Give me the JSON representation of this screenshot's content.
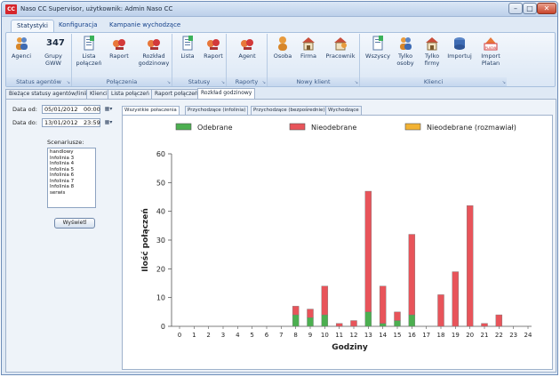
{
  "window": {
    "app_icon": "CC",
    "title": "Naso CC Supervisor, użytkownik: Admin Naso CC",
    "buttons": {
      "minimize": "–",
      "maximize": "□",
      "close": "✕"
    }
  },
  "ribbon_tabs": [
    "Statystyki",
    "Konfiguracja",
    "Kampanie wychodzące"
  ],
  "ribbon_groups": [
    {
      "name": "Status agentów",
      "buttons": [
        {
          "label": "Agenci",
          "icon": "agents-icon"
        },
        {
          "label": "Grupy GWW",
          "icon": "groups-counter-icon",
          "counter": "347"
        }
      ]
    },
    {
      "name": "Połączenia",
      "buttons": [
        {
          "label": "Lista połączeń",
          "icon": "list-icon"
        },
        {
          "label": "Raport",
          "icon": "report-icon"
        },
        {
          "label": "Rozkład godzinowy",
          "icon": "hourly-report-icon"
        }
      ]
    },
    {
      "name": "Statusy",
      "buttons": [
        {
          "label": "Lista",
          "icon": "list-icon"
        },
        {
          "label": "Raport",
          "icon": "report-icon"
        }
      ]
    },
    {
      "name": "Raporty",
      "buttons": [
        {
          "label": "Agent",
          "icon": "agent-report-icon"
        }
      ]
    },
    {
      "name": "Nowy klient",
      "buttons": [
        {
          "label": "Osoba",
          "icon": "person-icon"
        },
        {
          "label": "Firma",
          "icon": "company-icon"
        },
        {
          "label": "Pracownik",
          "icon": "employee-icon"
        }
      ]
    },
    {
      "name": "Klienci",
      "buttons": [
        {
          "label": "Wszyscy",
          "icon": "all-clients-icon"
        },
        {
          "label": "Tylko osoby",
          "icon": "persons-only-icon"
        },
        {
          "label": "Tylko firmy",
          "icon": "companies-only-icon"
        },
        {
          "label": "Importuj",
          "icon": "import-icon"
        },
        {
          "label": "Import Platan",
          "icon": "platan-import-icon",
          "badge": "PLATAN"
        }
      ]
    }
  ],
  "doc_tabs": [
    "Bieżące statusy agentów/linii",
    "Klienci",
    "Lista połączeń",
    "Raport połączeń",
    "Rozkład godzinowy"
  ],
  "filters": {
    "date_from_label": "Data od:",
    "date_from": "05/01/2012",
    "time_from": "00:00",
    "date_to_label": "Data do:",
    "date_to": "13/01/2012",
    "time_to": "23:59",
    "calendar_btn": "▦▾",
    "scenarios_label": "Scenariusze:",
    "scenarios": [
      "handlowy",
      "Infolinia 3",
      "Infolinia 4",
      "Infolinia 5",
      "Infolinia 6",
      "Infolinia 7",
      "Infolinia 8",
      "serwis"
    ],
    "show_button": "Wyświetl"
  },
  "inner_tabs": [
    "Wszystkie połaczenia",
    "Przychodzące (infolinia)",
    "Przychodzące (bezpośrednie)",
    "Wychodzące"
  ],
  "colors": {
    "answered": "#4caf50",
    "unanswered": "#e8545a",
    "unanswered_talked": "#f2b233"
  },
  "chart_data": {
    "type": "bar",
    "stacked": true,
    "title": "",
    "xlabel": "Godziny",
    "ylabel": "Ilość połączeń",
    "ylim": [
      0,
      60
    ],
    "yticks": [
      0,
      10,
      20,
      30,
      40,
      50,
      60
    ],
    "categories": [
      "0",
      "1",
      "2",
      "3",
      "4",
      "5",
      "6",
      "7",
      "8",
      "9",
      "10",
      "11",
      "12",
      "13",
      "14",
      "15",
      "16",
      "17",
      "18",
      "19",
      "20",
      "21",
      "22",
      "23",
      "24"
    ],
    "legend_position": "top",
    "grid": false,
    "series": [
      {
        "name": "Odebrane",
        "values": [
          0,
          0,
          0,
          0,
          0,
          0,
          0,
          0,
          4,
          3,
          4,
          0,
          0,
          5,
          1,
          2,
          4,
          0,
          0,
          0,
          0,
          0,
          0,
          0,
          0
        ]
      },
      {
        "name": "Nieodebrane",
        "values": [
          0,
          0,
          0,
          0,
          0,
          0,
          0,
          0,
          3,
          3,
          10,
          1,
          2,
          42,
          13,
          3,
          28,
          0,
          11,
          19,
          42,
          1,
          4,
          0,
          0
        ]
      },
      {
        "name": "Nieodebrane (rozmawiał)",
        "values": [
          0,
          0,
          0,
          0,
          0,
          0,
          0,
          0,
          0,
          0,
          0,
          0,
          0,
          0,
          0,
          0,
          0,
          0,
          0,
          0,
          0,
          0,
          0,
          0,
          0
        ]
      }
    ]
  }
}
